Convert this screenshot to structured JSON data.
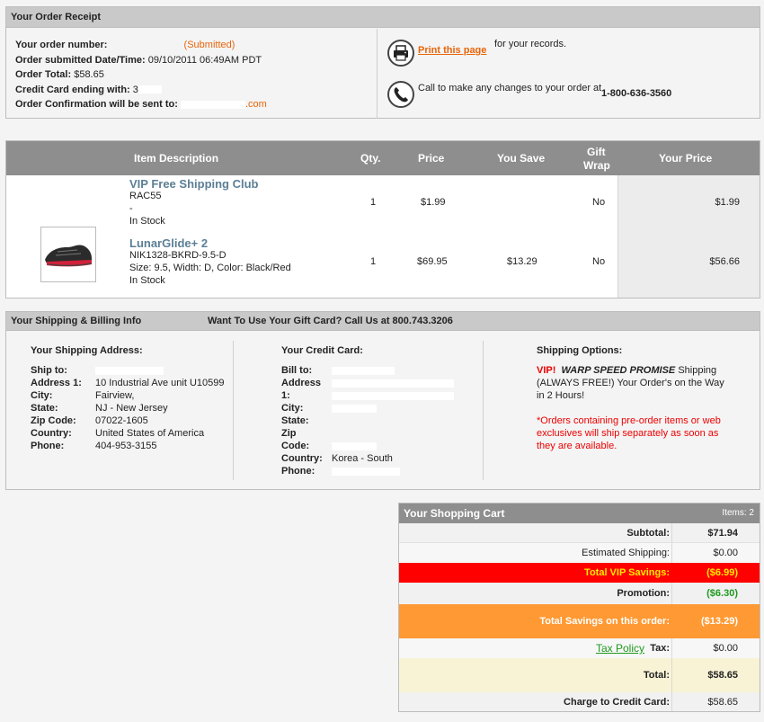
{
  "receipt": {
    "title": "Your Order Receipt",
    "order_number_label": "Your order number:",
    "order_number_value": "(Submitted)",
    "submitted_label": "Order submitted Date/Time:",
    "submitted_value": "09/10/2011 06:49AM PDT",
    "total_label": "Order Total:",
    "total_value": "$58.65",
    "cc_label": "Credit Card ending with:",
    "cc_value": "3",
    "confirm_label": "Order Confirmation will be sent to:",
    "confirm_value": ".com",
    "print_link": "Print this page",
    "print_suffix": "for your records.",
    "call_text": "Call to make any changes to your order at",
    "phone": "1-800-636-3560",
    "print_icon": "printer-icon",
    "phone_icon": "phone-icon"
  },
  "items_table": {
    "headers": {
      "description": "Item Description",
      "qty": "Qty.",
      "price": "Price",
      "you_save": "You Save",
      "gift_wrap_1": "Gift",
      "gift_wrap_2": "Wrap",
      "your_price": "Your Price"
    },
    "rows": [
      {
        "name": "VIP Free Shipping Club",
        "sku": "RAC55",
        "detail": "-",
        "stock": "In Stock",
        "qty": "1",
        "price": "$1.99",
        "you_save": "",
        "gift_wrap": "No",
        "your_price": "$1.99"
      },
      {
        "name": "LunarGlide+ 2",
        "sku": "NIK1328-BKRD-9.5-D",
        "detail": "Size: 9.5, Width: D, Color: Black/Red",
        "stock": "In Stock",
        "qty": "1",
        "price": "$69.95",
        "you_save": "$13.29",
        "gift_wrap": "No",
        "your_price": "$56.66"
      }
    ]
  },
  "shipping": {
    "title": "Your Shipping & Billing Info",
    "gift_card": "Want To Use Your Gift Card? Call Us at 800.743.3206",
    "address_heading": "Your Shipping Address:",
    "address": {
      "ship_to_label": "Ship to:",
      "address1_label": "Address 1:",
      "address1_value": "10 Industrial Ave unit U10599",
      "city_label": "City:",
      "city_value": "Fairview,",
      "state_label": "State:",
      "state_value": "NJ - New Jersey",
      "zip_label": "Zip Code:",
      "zip_value": "07022-1605",
      "country_label": "Country:",
      "country_value": "United States of America",
      "phone_label": "Phone:",
      "phone_value": "404-953-3155"
    },
    "card_heading": "Your Credit Card:",
    "card": {
      "bill_to_label": "Bill to:",
      "address_label": "Address",
      "address_label_2": "1:",
      "city_label": "City:",
      "state_label": "State:",
      "zip_label": "Zip",
      "zip_label_2": "Code:",
      "country_label": "Country:",
      "country_value": "Korea - South",
      "phone_label": "Phone:"
    },
    "options_heading": "Shipping Options:",
    "vip": "VIP!",
    "warp": "WARP SPEED PROMISE",
    "shipping_word": "Shipping",
    "warp_line2": "(ALWAYS FREE!) Your Order's on the Way",
    "warp_line3": "in 2 Hours!",
    "note_line1": "*Orders containing pre-order items or web",
    "note_line2": "exclusives will ship separately as soon as",
    "note_line3": "they are available."
  },
  "cart": {
    "title": "Your Shopping Cart",
    "items_count": "Items: 2",
    "subtotal_label": "Subtotal:",
    "subtotal_value": "$71.94",
    "est_shipping_label": "Estimated Shipping:",
    "est_shipping_value": "$0.00",
    "vip_savings_label": "Total VIP Savings:",
    "vip_savings_value": "($6.99)",
    "promotion_label": "Promotion:",
    "promotion_value": "($6.30)",
    "total_savings_label": "Total Savings on this order:",
    "total_savings_value": "($13.29)",
    "tax_policy_link": "Tax Policy",
    "tax_label": "Tax:",
    "tax_value": "$0.00",
    "total_label": "Total:",
    "total_value": "$58.65",
    "charge_label": "Charge to Credit Card:",
    "charge_value": "$58.65"
  },
  "colors": {
    "accent_orange": "#e8650a",
    "vip_red": "#ff0000",
    "savings_orange": "#ff9933",
    "promo_green": "#1f9a1f",
    "product_blue": "#5b7f95"
  }
}
